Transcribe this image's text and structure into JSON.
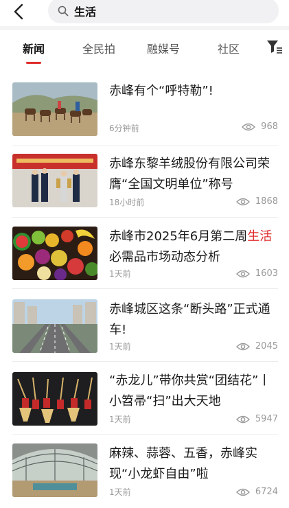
{
  "search": {
    "query": "生活"
  },
  "tabs": [
    {
      "label": "新闻"
    },
    {
      "label": "全民拍"
    },
    {
      "label": "融媒号"
    },
    {
      "label": "社区"
    }
  ],
  "news": [
    {
      "title": "赤峰有个“呼特勒”!",
      "time": "6分钟前",
      "views": "968"
    },
    {
      "title": "赤峰东黎羊绒股份有限公司荣膺“全国文明单位”称号",
      "time": "18小时前",
      "views": "1868"
    },
    {
      "title_pre": "赤峰市2025年6月第二周",
      "title_hl": "生活",
      "title_post": "必需品市场动态分析",
      "time": "1天前",
      "views": "1603"
    },
    {
      "title": "赤峰城区这条“断头路”正式通车!",
      "time": "1天前",
      "views": "2045"
    },
    {
      "title": "“赤龙儿”带你共赏“团结花”丨小笤帚“扫”出大天地",
      "time": "1天前",
      "views": "5947"
    },
    {
      "title": "麻辣、蒜蓉、五香，赤峰实现“小龙虾自由”啦",
      "time": "1天前",
      "views": "6724"
    }
  ],
  "colors": {
    "accent": "#e02b2b",
    "muted": "#9a9a9a"
  },
  "icons": {
    "back": "chevron-left-icon",
    "search": "search-icon",
    "filter": "filter-icon",
    "views": "eye-icon"
  }
}
